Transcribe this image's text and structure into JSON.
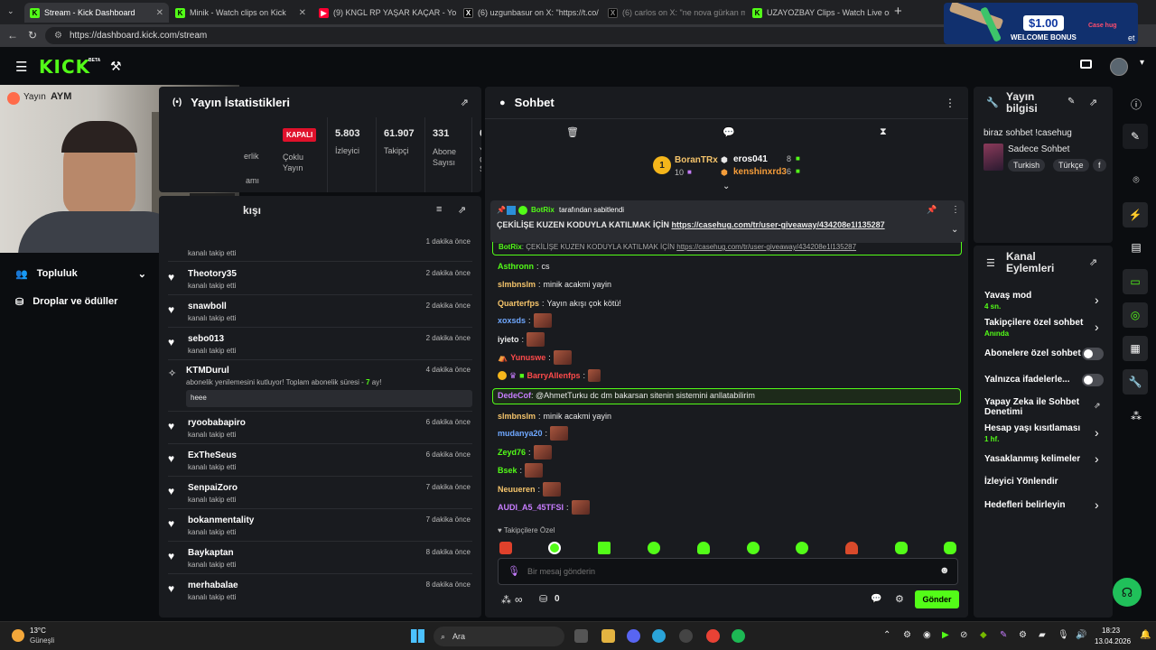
{
  "browser": {
    "tabs": [
      {
        "title": "Stream - Kick Dashboard",
        "favicon": "K",
        "color": "#53fc18"
      },
      {
        "title": "Minik - Watch clips on Kick",
        "favicon": "K",
        "color": "#53fc18"
      },
      {
        "title": "(9) KNGL RP YAŞAR KAÇAR - YouT",
        "favicon": "▶",
        "color": "#ff0033"
      },
      {
        "title": "(6) uzgunbasur on X: \"https://t.co/",
        "favicon": "X",
        "color": "#ffffff"
      },
      {
        "title": "(6) carlos on X: \"ne nova gürkan m",
        "favicon": "X",
        "color": "#ffffff"
      },
      {
        "title": "UZAYOZBAY Clips - Watch Live on",
        "favicon": "K",
        "color": "#53fc18"
      }
    ],
    "url": "https://dashboard.kick.com/stream",
    "promo": {
      "amount": "$1.00",
      "label": "WELCOME BONUS",
      "brand": "Case hug",
      "edge": "et"
    }
  },
  "nav": {
    "logo": "KICK",
    "beta": "BETA"
  },
  "left_sidebar": {
    "overlay_label": "Yayın",
    "overlay_tag": "AYM",
    "items": [
      {
        "label": "Topluluk",
        "icon": "users-icon"
      },
      {
        "label": "Droplar ve ödüller",
        "icon": "gift-icon"
      }
    ]
  },
  "stats": {
    "title": "Yayın İstatistikleri",
    "live_badge": "KAPALI",
    "badge_sub": "Çoklu Yayın",
    "partial_text": "erlik",
    "partial_text2": "amı",
    "viewers_value": "5.803",
    "viewers_label": "İzleyici",
    "followers_value": "61.907",
    "followers_label": "Takipçi",
    "subs_value": "331",
    "subs_label": "Abone Sayısı",
    "extra_value": "0",
    "extra_label": "Y",
    "extra_label2": "C",
    "extra_label3": "S"
  },
  "activity": {
    "title": "kışı",
    "first_time": "1 dakika önce",
    "first_sub": "kanalı takip etti",
    "items": [
      {
        "name": "Theotory35",
        "sub": "kanalı takip etti",
        "time": "2 dakika önce"
      },
      {
        "name": "snawboll",
        "sub": "kanalı takip etti",
        "time": "2 dakika önce"
      },
      {
        "name": "sebo013",
        "sub": "kanalı takip etti",
        "time": "2 dakika önce"
      }
    ],
    "resub": {
      "name": "KTMDurul",
      "sub": "abonelik yenilemesini kutluyor! Toplam abonelik süresi - ",
      "months": "7",
      "unit": " ay!",
      "message": "heee",
      "time": "4 dakika önce"
    },
    "items2": [
      {
        "name": "ryoobabapiro",
        "sub": "kanalı takip etti",
        "time": "6 dakika önce"
      },
      {
        "name": "ExTheSeus",
        "sub": "kanalı takip etti",
        "time": "6 dakika önce"
      },
      {
        "name": "SenpaiZoro",
        "sub": "kanalı takip etti",
        "time": "7 dakika önce"
      },
      {
        "name": "bokanmentality",
        "sub": "kanalı takip etti",
        "time": "7 dakika önce"
      },
      {
        "name": "Baykaptan",
        "sub": "kanalı takip etti",
        "time": "8 dakika önce"
      },
      {
        "name": "merhabalae",
        "sub": "kanalı takip etti",
        "time": "8 dakika önce"
      }
    ]
  },
  "chat": {
    "title": "Sohbet",
    "top_gifter": {
      "name": "BoranTRx",
      "count": "10"
    },
    "gifters": [
      {
        "name": "eros041",
        "count": "8"
      },
      {
        "name": "kenshinxrd3",
        "count": "6"
      }
    ],
    "pinned": {
      "by": "BotRix",
      "by_label": "tarafından sabitlendi",
      "text": "ÇEKİLİŞE KUZEN KODUYLA KATILMAK İÇİN ",
      "link": "https://casehug.com/tr/user-giveaway/434208e1l135287"
    },
    "echo": {
      "name": "BotRix",
      "text": "ÇEKİLİŞE KUZEN KODUYLA KATILMAK İÇİN ",
      "link": "https://casehug.com/tr/user-giveaway/434208e1l135287"
    },
    "messages": [
      {
        "user": "Asthronn",
        "color": "#53fc18",
        "text": "cs"
      },
      {
        "user": "slmbnslm",
        "color": "#f5c46b",
        "text": "minik acakmi yayin"
      },
      {
        "user": "Quarterfps",
        "color": "#f5c46b",
        "text": "Yayın akışı çok kötü!"
      },
      {
        "user": "xoxsds",
        "color": "#6fa8ff",
        "text": "",
        "emote": true
      },
      {
        "user": "iyieto",
        "color": "#e8e8e8",
        "text": "",
        "emote": true
      },
      {
        "user": "Yunuswe",
        "color": "#ff4b4b",
        "text": "",
        "emote": true
      },
      {
        "user": "BarryAllenfps",
        "color": "#ff4b4b",
        "text": "",
        "emote": true
      },
      {
        "user": "DedeCof",
        "color": "#c77dff",
        "text": "@AhmetTurku dc dm bakarsan sitenin sistemini anllatabilirim",
        "mention": true
      },
      {
        "user": "slmbnslm",
        "color": "#f5c46b",
        "text": "minik acakmi yayin"
      },
      {
        "user": "mudanya20",
        "color": "#6fa8ff",
        "text": "",
        "emote": true
      },
      {
        "user": "Zeyd76",
        "color": "#53fc18",
        "text": "",
        "emote": true
      },
      {
        "user": "Bsek",
        "color": "#53fc18",
        "text": "",
        "emote": true
      },
      {
        "user": "Neuueren",
        "color": "#f5c46b",
        "text": "",
        "emote": true
      },
      {
        "user": "AUDI_A5_45TFSI",
        "color": "#c77dff",
        "text": "",
        "emote": true
      }
    ],
    "followers_only": "Takipçilere Özel",
    "input_placeholder": "Bir mesaj gönderin",
    "points": "∞",
    "gift_count": "0",
    "send_label": "Gönder"
  },
  "stream_info": {
    "title": "Yayın bilgisi",
    "stream_title": "biraz sohbet !casehug",
    "category": "Sadece Sohbet",
    "tags": [
      "Turkish",
      "Türkçe",
      "f"
    ]
  },
  "channel_actions": {
    "title": "Kanal Eylemleri",
    "items": [
      {
        "label": "Yavaş mod",
        "sub": "4 sn.",
        "type": "chevron"
      },
      {
        "label": "Takipçilere özel sohbet",
        "sub": "Anında",
        "type": "chevron"
      },
      {
        "label": "Abonelere özel sohbet",
        "sub": "",
        "type": "toggle"
      },
      {
        "label": "Yalnızca ifadelerle...",
        "sub": "",
        "type": "toggle"
      },
      {
        "label": "Yapay Zeka ile Sohbet Denetimi",
        "sub": "",
        "type": "external"
      },
      {
        "label": "Hesap yaşı kısıtlaması",
        "sub": "1 hf.",
        "type": "chevron"
      },
      {
        "label": "Yasaklanmış kelimeler",
        "sub": "",
        "type": "chevron"
      },
      {
        "label": "İzleyici Yönlendir",
        "sub": "",
        "type": "none"
      },
      {
        "label": "Hedefleri belirleyin",
        "sub": "",
        "type": "chevron"
      }
    ]
  },
  "taskbar": {
    "weather_temp": "13°C",
    "weather_desc": "Güneşli",
    "search_label": "Ara",
    "time": "18:23",
    "date": "13.04.2026"
  }
}
